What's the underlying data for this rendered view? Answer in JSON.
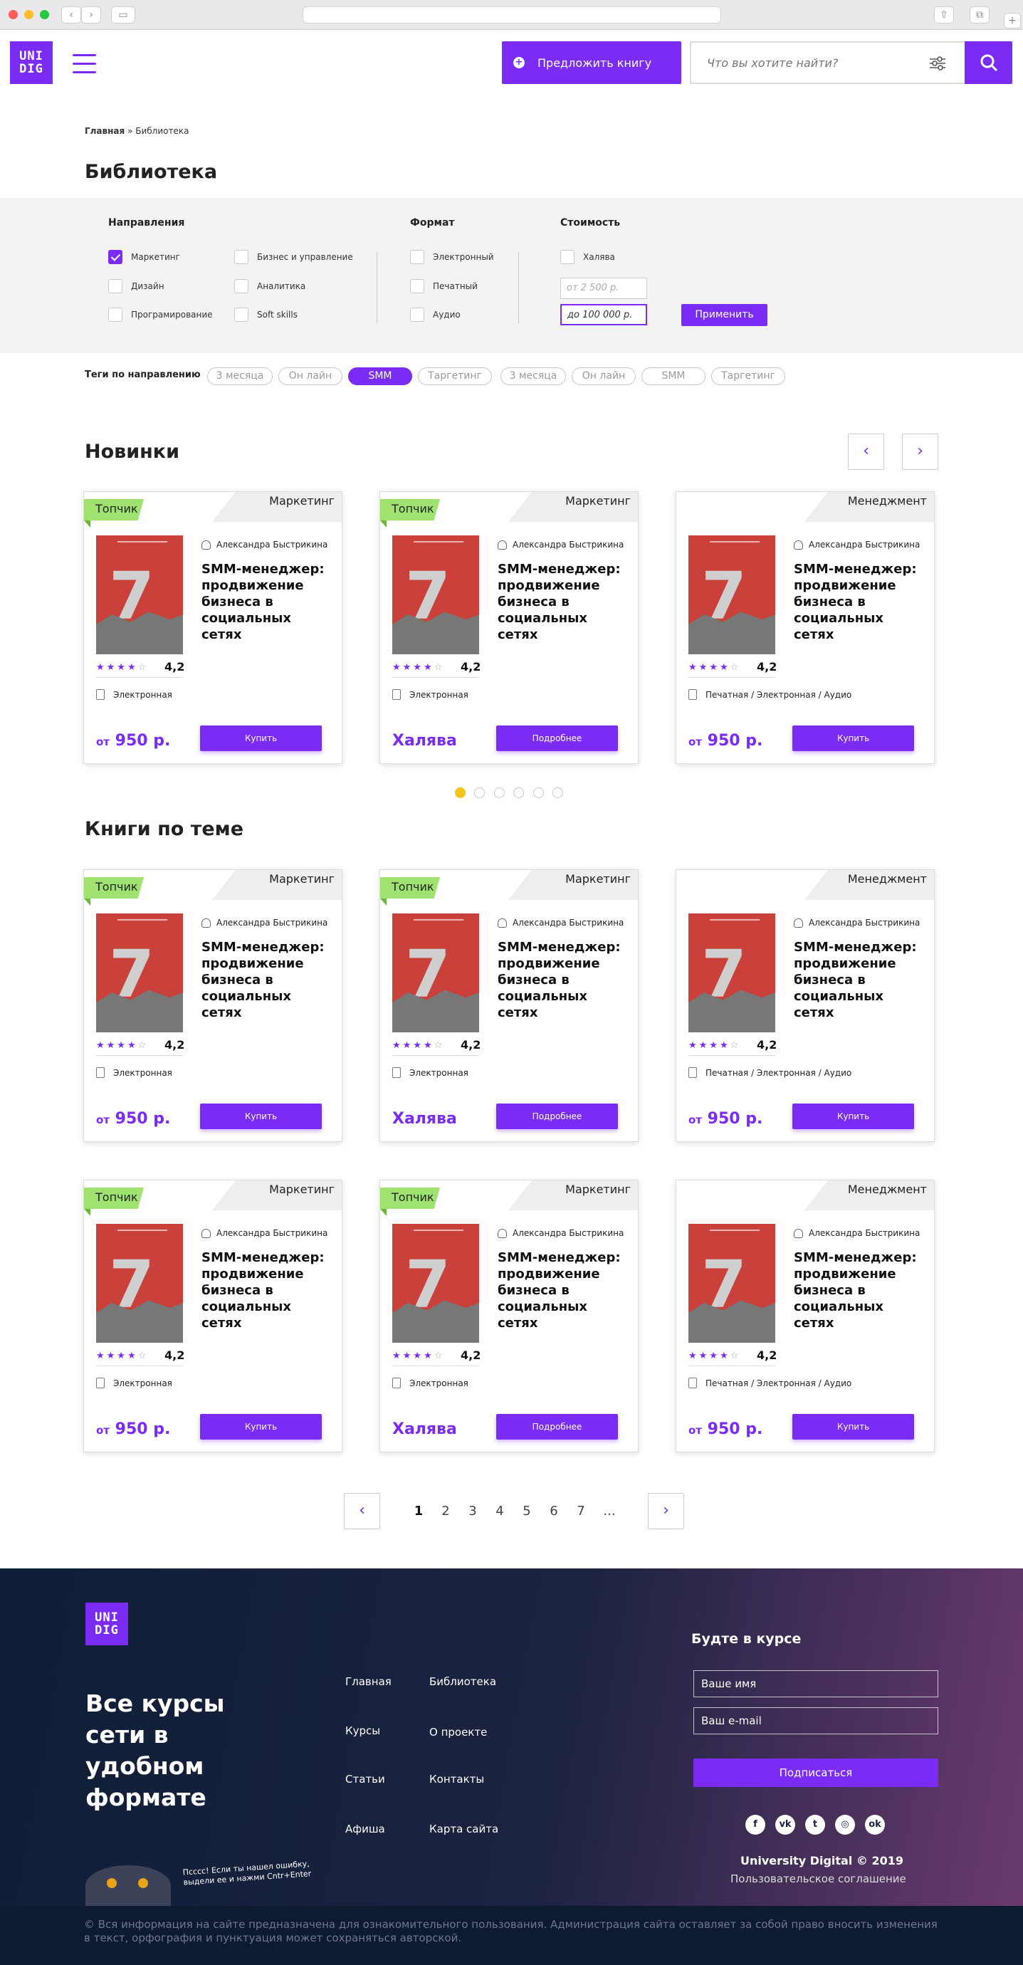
{
  "header": {
    "logo": "UNI DIG",
    "suggest_label": "Предложить книгу",
    "search_placeholder": "Что вы хотите найти?"
  },
  "breadcrumb": {
    "home": "Главная",
    "sep": "»",
    "current": "Библиотека"
  },
  "page_title": "Библиотека",
  "filters": {
    "directions_title": "Направления",
    "directions": [
      {
        "label": "Маркетинг",
        "checked": true
      },
      {
        "label": "Бизнес и управление",
        "checked": false
      },
      {
        "label": "Дизайн",
        "checked": false
      },
      {
        "label": "Аналитика",
        "checked": false
      },
      {
        "label": "Програмирование",
        "checked": false
      },
      {
        "label": "Soft skills",
        "checked": false
      }
    ],
    "format_title": "Формат",
    "formats": [
      "Электронный",
      "Печатный",
      "Аудио"
    ],
    "cost_title": "Стоимость",
    "free_label": "Халява",
    "price_from": "от 2 500 р.",
    "price_to": "до 100 000 р.",
    "apply": "Применить"
  },
  "tags": {
    "label": "Теги по направлению",
    "items": [
      "3 месяца",
      "Он лайн",
      "SMM",
      "Таргетинг",
      "3 месяца",
      "Он лайн",
      "SMM",
      "Таргетинг"
    ],
    "active_index": 2
  },
  "sections": {
    "new": "Новинки",
    "topic": "Книги по теме"
  },
  "cards": [
    {
      "badge": "Топчик",
      "category": "Маркетинг",
      "author": "Александра Быстрикина",
      "title": "SMM-менеджер: продвижение бизнеса в социальных сетях",
      "rating": "4,2",
      "stars": 4,
      "format": "Электронная",
      "price_prefix": "от",
      "price": "950 р.",
      "button": "Купить"
    },
    {
      "badge": "Топчик",
      "category": "Маркетинг",
      "author": "Александра Быстрикина",
      "title": "SMM-менеджер: продвижение бизнеса в социальных сетях",
      "rating": "4,2",
      "stars": 4,
      "format": "Электронная",
      "price_prefix": "",
      "price": "Халява",
      "button": "Подробнее"
    },
    {
      "badge": "",
      "category": "Менеджмент",
      "author": "Александра Быстрикина",
      "title": "SMM-менеджер: продвижение бизнеса в социальных сетях",
      "rating": "4,2",
      "stars": 4,
      "format": "Печатная / Электронная / Аудио",
      "price_prefix": "от",
      "price": "950 р.",
      "button": "Купить"
    }
  ],
  "pagination": {
    "pages": [
      "1",
      "2",
      "3",
      "4",
      "5",
      "6",
      "7",
      "..."
    ],
    "current": "1"
  },
  "footer": {
    "logo": "UNI DIG",
    "slogan": "Все курсы сети в удобном формате",
    "links": [
      "Главная",
      "Библиотека",
      "Курсы",
      "О проекте",
      "Статьи",
      "Контакты",
      "Афиша",
      "Карта сайта"
    ],
    "subscribe_title": "Будте в курсе",
    "name_placeholder": "Ваше имя",
    "email_placeholder": "Ваш e-mail",
    "subscribe_button": "Подписаться",
    "socials": [
      "facebook-icon",
      "vk-icon",
      "twitter-icon",
      "instagram-icon",
      "odnoklassniki-icon"
    ],
    "copyright": "University Digital © 2019",
    "agreement": "Пользовательское соглашение",
    "owl_note": "Псссс! Если ты нашел ошибку, выдели ее и нажми Cntr+Enter",
    "disclaimer": "© Вся информация на сайте предназначена для ознакомительного пользования. Администрация сайта оставляет за собой право вносить изменения в текст, орфография и пунктуация может сохраняться авторской."
  },
  "colors": {
    "accent": "#7a2cf5",
    "badge": "#9fe270",
    "footer_dark": "#0f1e37"
  }
}
